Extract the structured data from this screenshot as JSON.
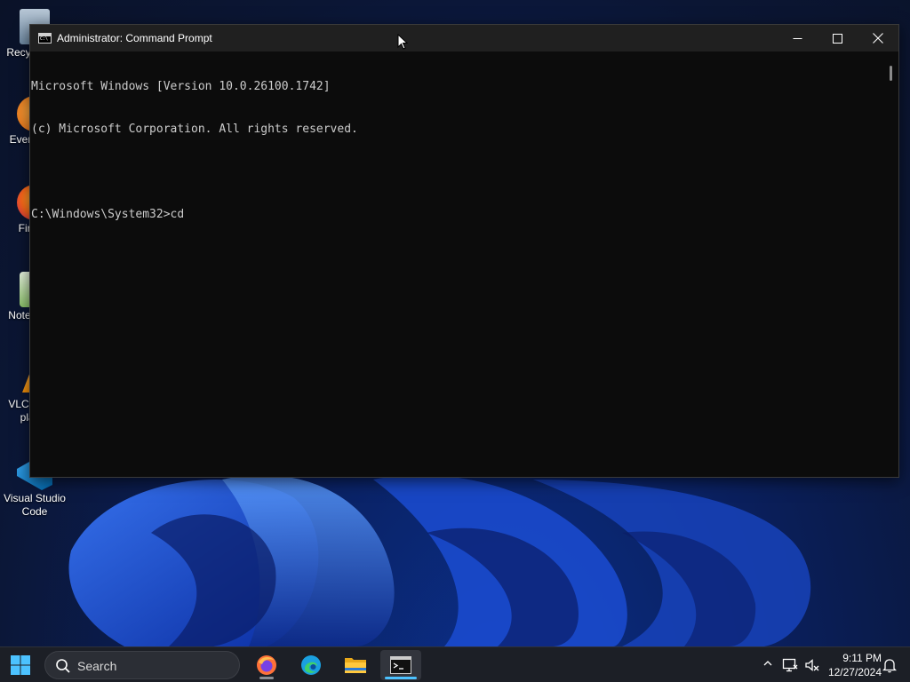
{
  "desktop": {
    "icons": [
      {
        "label": "Recycle Bin",
        "icon": "recycle-bin-icon"
      },
      {
        "label": "Everything",
        "icon": "everything-icon"
      },
      {
        "label": "Firefox",
        "icon": "firefox-icon"
      },
      {
        "label": "Notepad++",
        "icon": "notepad-plus-plus-icon"
      },
      {
        "label": "VLC media player",
        "icon": "vlc-icon"
      },
      {
        "label": "Visual Studio Code",
        "icon": "vscode-icon"
      }
    ]
  },
  "window": {
    "title": "Administrator: Command Prompt",
    "icon": "cmd-icon",
    "controls": {
      "minimize": "minimize-icon",
      "maximize": "maximize-icon",
      "close": "close-icon"
    },
    "console_lines": [
      "Microsoft Windows [Version 10.0.26100.1742]",
      "(c) Microsoft Corporation. All rights reserved.",
      "",
      "C:\\Windows\\System32>cd"
    ]
  },
  "taskbar": {
    "search_label": "Search",
    "apps": [
      {
        "name": "Firefox",
        "icon": "firefox-icon",
        "active": false
      },
      {
        "name": "Microsoft Edge",
        "icon": "edge-icon",
        "active": false
      },
      {
        "name": "File Explorer",
        "icon": "folder-icon",
        "active": false
      },
      {
        "name": "Command Prompt",
        "icon": "terminal-icon",
        "active": true
      }
    ],
    "tray": {
      "time": "9:11 PM",
      "date": "12/27/2024"
    }
  },
  "colors": {
    "console_bg": "#0c0c0c",
    "console_text": "#cccccc",
    "titlebar_bg": "#202020",
    "taskbar_bg": "#1c1f26",
    "accent": "#4cc2ff"
  }
}
